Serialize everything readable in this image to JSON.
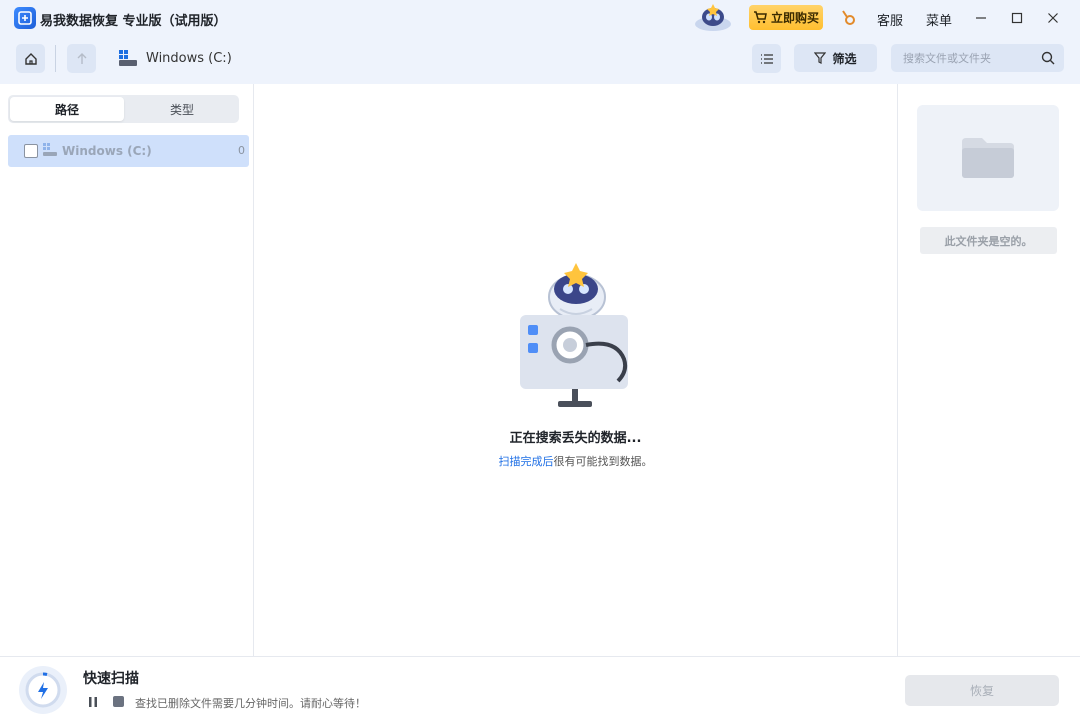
{
  "titlebar": {
    "app_title": "易我数据恢复 专业版（试用版）",
    "buy_label": "立即购买",
    "support_label": "客服",
    "menu_label": "菜单"
  },
  "toolbar": {
    "drive_label": "Windows (C:)",
    "filter_label": "筛选",
    "search_placeholder": "搜索文件或文件夹"
  },
  "left": {
    "tabs": [
      {
        "label": "路径",
        "active": true
      },
      {
        "label": "类型",
        "active": false
      }
    ],
    "tree": [
      {
        "label": "Windows (C:)",
        "count": "0",
        "checked": false
      }
    ]
  },
  "center": {
    "status_main": "正在搜索丢失的数据...",
    "status_sub_link": "扫描完成后",
    "status_sub_rest": "很有可能找到数据。"
  },
  "right": {
    "empty_text": "此文件夹是空的。"
  },
  "bottom": {
    "scan_title": "快速扫描",
    "scan_desc": "查找已删除文件需要几分钟时间。请耐心等待！",
    "recover_label": "恢复"
  },
  "colors": {
    "accent": "#1f6fe5",
    "buy_button": "#ffc43d",
    "selected_row": "#cfe0fb",
    "chrome_bg": "#eef3fc"
  }
}
